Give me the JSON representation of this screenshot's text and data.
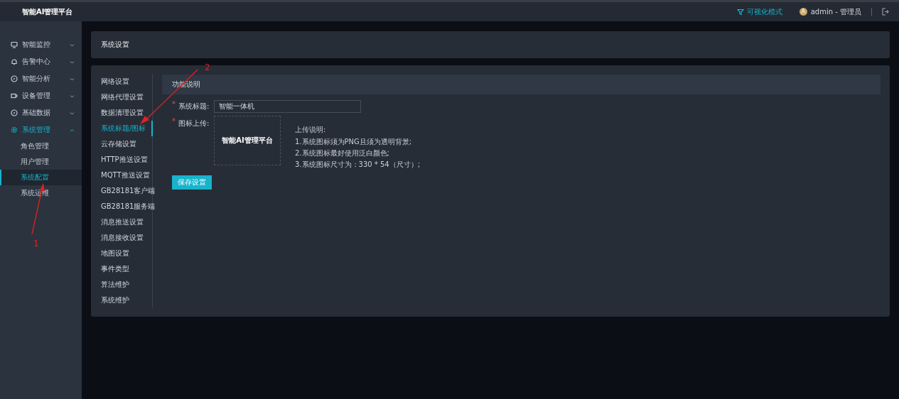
{
  "app_title": "智能AI管理平台",
  "topbar": {
    "mode_link": "可视化模式",
    "avatar_initial": "A",
    "user": "admin - 管理员"
  },
  "sidebar": {
    "items": [
      {
        "label": "智能监控",
        "expanded": false,
        "selected": false
      },
      {
        "label": "告警中心",
        "expanded": false,
        "selected": false
      },
      {
        "label": "智能分析",
        "expanded": false,
        "selected": false
      },
      {
        "label": "设备管理",
        "expanded": false,
        "selected": false
      },
      {
        "label": "基础数据",
        "expanded": false,
        "selected": false
      },
      {
        "label": "系统管理",
        "expanded": true,
        "selected": true,
        "children": [
          {
            "label": "角色管理",
            "selected": false
          },
          {
            "label": "用户管理",
            "selected": false
          },
          {
            "label": "系统配置",
            "selected": true
          },
          {
            "label": "系统运维",
            "selected": false
          }
        ]
      }
    ]
  },
  "page_title": "系统设置",
  "settings_menu": [
    {
      "label": "网络设置",
      "selected": false
    },
    {
      "label": "网络代理设置",
      "selected": false
    },
    {
      "label": "数据清理设置",
      "selected": false
    },
    {
      "label": "系统标题/图标",
      "selected": true
    },
    {
      "label": "云存储设置",
      "selected": false
    },
    {
      "label": "HTTP推送设置",
      "selected": false
    },
    {
      "label": "MQTT推送设置",
      "selected": false
    },
    {
      "label": "GB28181客户端",
      "selected": false
    },
    {
      "label": "GB28181服务端",
      "selected": false
    },
    {
      "label": "消息推送设置",
      "selected": false
    },
    {
      "label": "消息接收设置",
      "selected": false
    },
    {
      "label": "地图设置",
      "selected": false
    },
    {
      "label": "事件类型",
      "selected": false
    },
    {
      "label": "算法维护",
      "selected": false
    },
    {
      "label": "系统维护",
      "selected": false
    }
  ],
  "section_title": "功能说明",
  "form": {
    "title_required": "*",
    "title_label": "系统标题:",
    "title_value": "智能一体机",
    "icon_required": "*",
    "icon_label": "图标上传:",
    "preview_text": "智能AI管理平台",
    "notes_title": "上传说明:",
    "notes": [
      "1.系统图标须为PNG且须为透明背景;",
      "2.系统图标最好使用泛白颜色;",
      "3.系统图标尺寸为：330 * 54（尺寸）;"
    ],
    "save_button": "保存设置"
  },
  "annotations": [
    {
      "label": "1"
    },
    {
      "label": "2"
    }
  ]
}
